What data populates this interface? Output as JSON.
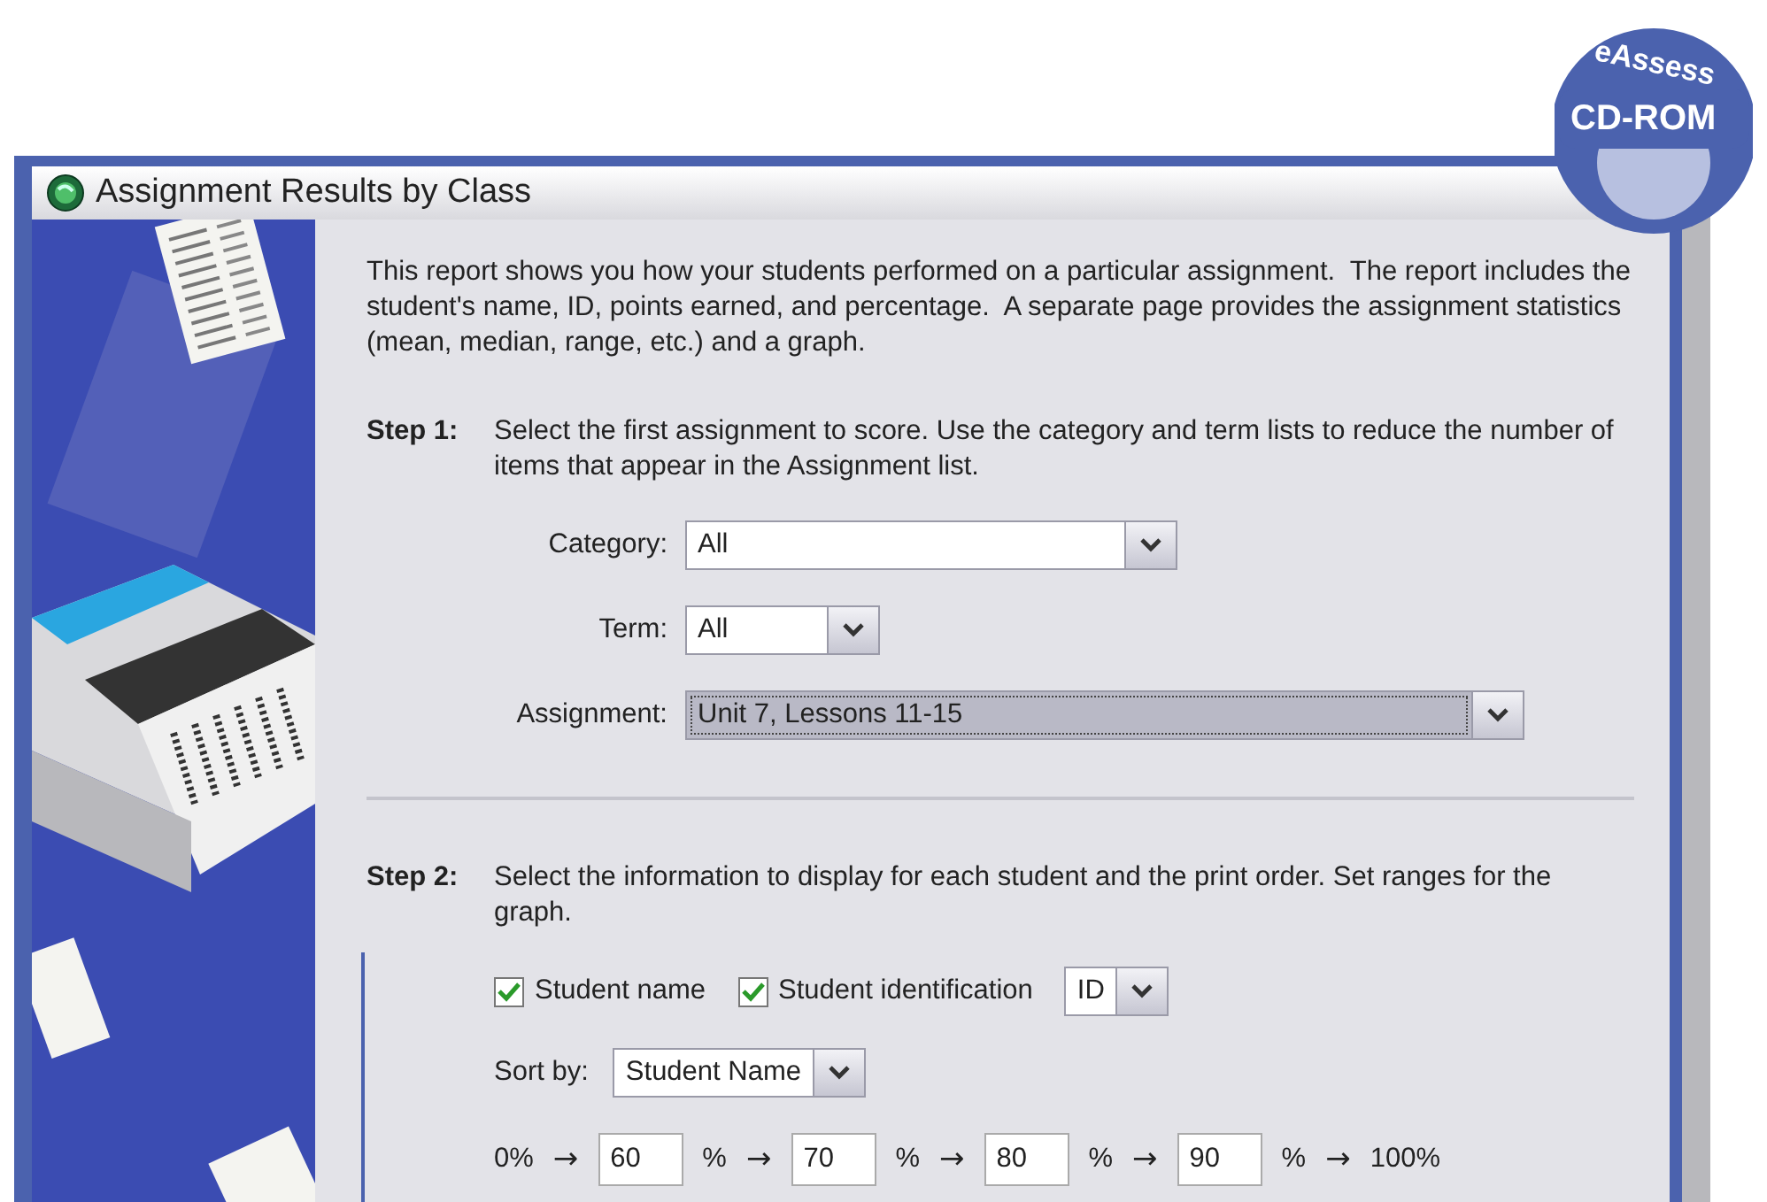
{
  "badge": {
    "top": "eAssess",
    "bottom": "CD-ROM"
  },
  "window": {
    "title": "Assignment Results by Class"
  },
  "intro": "This report shows you how your students performed on a particular assignment.  The report includes the student's name, ID, points earned, and percentage.  A separate page provides the assignment statistics (mean, median, range, etc.) and a graph.",
  "step1": {
    "label": "Step 1:",
    "text": "Select the first assignment to score. Use the category and term lists to reduce the number of items that appear in the Assignment list.",
    "fields": [
      {
        "label": "Category:",
        "value": "All",
        "focused": false
      },
      {
        "label": "Term:",
        "value": "All",
        "focused": false
      },
      {
        "label": "Assignment:",
        "value": "Unit 7, Lessons 11-15",
        "focused": true
      }
    ]
  },
  "step2": {
    "label": "Step 2:",
    "text": "Select the information to display for each student and the print order.  Set ranges for the graph.",
    "checks": [
      {
        "label": "Student name",
        "checked": true
      },
      {
        "label": "Student identification",
        "checked": true
      }
    ],
    "id_select": {
      "value": "ID"
    },
    "sort": {
      "label": "Sort by:",
      "value": "Student Name"
    },
    "ranges": [
      {
        "kind": "text",
        "text": "0%"
      },
      {
        "kind": "arrow",
        "text": "→"
      },
      {
        "kind": "field",
        "value": "60"
      },
      {
        "kind": "text",
        "text": "%"
      },
      {
        "kind": "arrow",
        "text": "→"
      },
      {
        "kind": "field",
        "value": "70"
      },
      {
        "kind": "text",
        "text": "%"
      },
      {
        "kind": "arrow",
        "text": "→"
      },
      {
        "kind": "field",
        "value": "80"
      },
      {
        "kind": "text",
        "text": "%"
      },
      {
        "kind": "arrow",
        "text": "→"
      },
      {
        "kind": "field",
        "value": "90"
      },
      {
        "kind": "text",
        "text": "%"
      },
      {
        "kind": "arrow",
        "text": "→"
      },
      {
        "kind": "text",
        "text": "100%"
      }
    ]
  }
}
